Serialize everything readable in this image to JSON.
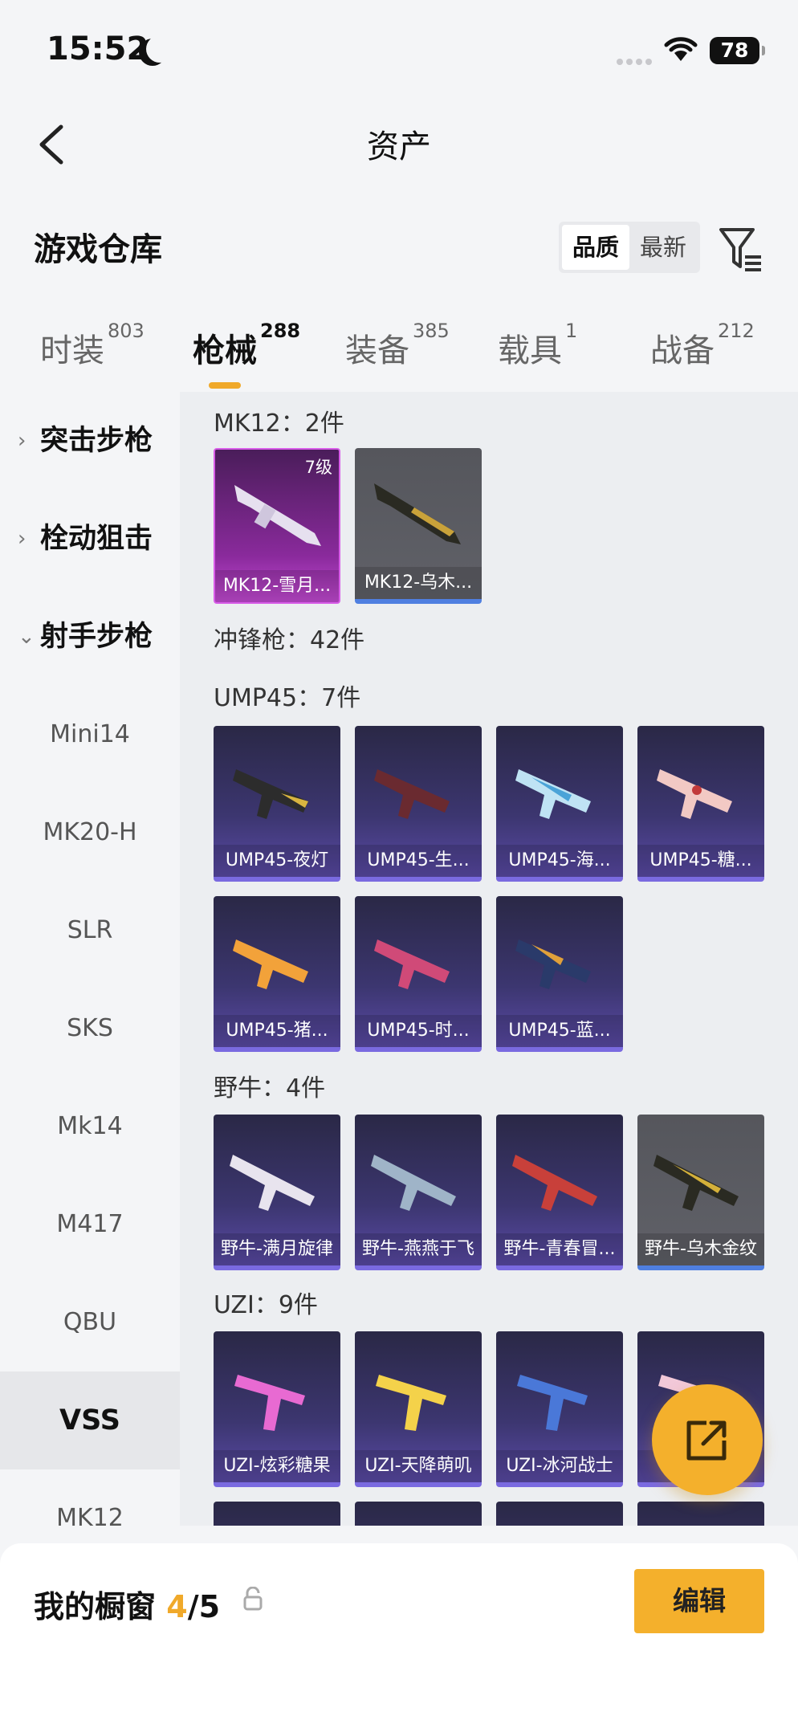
{
  "status": {
    "time": "15:52",
    "battery": "78"
  },
  "nav": {
    "title": "资产"
  },
  "section": {
    "title": "游戏仓库",
    "sort_options": [
      "品质",
      "最新"
    ],
    "sort_selected": "品质"
  },
  "tabs": [
    {
      "label": "时装",
      "count": "803"
    },
    {
      "label": "枪械",
      "count": "288"
    },
    {
      "label": "装备",
      "count": "385"
    },
    {
      "label": "载具",
      "count": "1"
    },
    {
      "label": "战备",
      "count": "212"
    }
  ],
  "sidebar": {
    "groups": [
      {
        "label": "突击步枪",
        "chev": "›"
      },
      {
        "label": "栓动狙击",
        "chev": "›"
      },
      {
        "label": "射手步枪",
        "chev": "⌄"
      }
    ],
    "items": [
      "Mini14",
      "MK20-H",
      "SLR",
      "SKS",
      "Mk14",
      "M417",
      "QBU",
      "VSS",
      "MK12"
    ],
    "selected": "VSS"
  },
  "main": {
    "mk12_label": "MK12：2件",
    "mk12": [
      {
        "name": "MK12-雪月...",
        "level": "7级",
        "style": "pink"
      },
      {
        "name": "MK12-乌木...",
        "style": "gray"
      }
    ],
    "smg_label": "冲锋枪：42件",
    "ump_label": "UMP45：7件",
    "ump": [
      {
        "name": "UMP45-夜灯"
      },
      {
        "name": "UMP45-生..."
      },
      {
        "name": "UMP45-海..."
      },
      {
        "name": "UMP45-糖..."
      },
      {
        "name": "UMP45-猪..."
      },
      {
        "name": "UMP45-时..."
      },
      {
        "name": "UMP45-蓝..."
      }
    ],
    "bison_label": "野牛：4件",
    "bison": [
      {
        "name": "野牛-满月旋律"
      },
      {
        "name": "野牛-燕燕于飞"
      },
      {
        "name": "野牛-青春冒..."
      },
      {
        "name": "野牛-乌木金纹",
        "style": "gray"
      }
    ],
    "uzi_label": "UZI：9件",
    "uzi": [
      {
        "name": "UZI-炫彩糖果"
      },
      {
        "name": "UZI-天降萌叽"
      },
      {
        "name": "UZI-冰河战士"
      },
      {
        "name": "U"
      }
    ]
  },
  "colors": {
    "accent": "#f4b02c",
    "card_blue": "#3c3670",
    "card_pink": "#8a2a9c",
    "card_gray": "#5a5b61"
  },
  "icons": {
    "back": "back-arrow-icon",
    "filter": "filter-icon",
    "share": "share-icon",
    "lock": "lock-icon"
  },
  "bottom": {
    "title": "我的橱窗",
    "count": "4",
    "total": "/5",
    "edit_label": "编辑"
  }
}
